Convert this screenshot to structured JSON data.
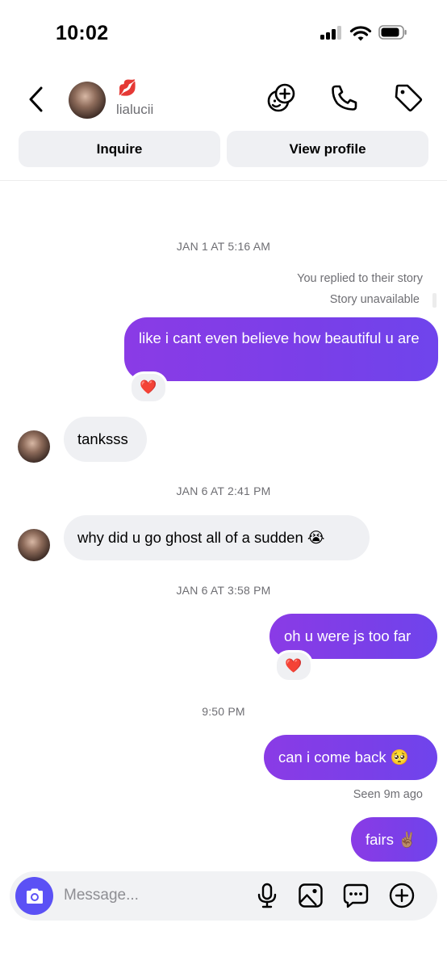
{
  "status_bar": {
    "time": "10:02"
  },
  "header": {
    "username": "lialucii",
    "emoji": "💋",
    "inquire_label": "Inquire",
    "view_profile_label": "View profile"
  },
  "messages": {
    "stamp1": "JAN 1 AT 5:16 AM",
    "story_reply": "You replied to their story",
    "story_unavailable": "Story unavailable",
    "out1": "like i cant even believe how beautiful u are",
    "react1": "❤️",
    "in1": "tanksss",
    "stamp2": "JAN 6 AT 2:41 PM",
    "in2": "why did u go ghost all of a sudden 😭",
    "stamp3": "JAN 6 AT 3:58 PM",
    "out2": "oh u were js too far",
    "react2": "❤️",
    "stamp4": "9:50 PM",
    "out3": "can i come back 🥺",
    "seen": "Seen 9m ago",
    "out4": "fairs ✌🏽"
  },
  "composer": {
    "placeholder": "Message..."
  },
  "icons": {
    "back": "chevron-left-icon",
    "stickers": "add-sticker-icon",
    "call": "phone-icon",
    "tag": "tag-icon",
    "camera": "camera-icon",
    "mic": "microphone-icon",
    "gallery": "image-icon",
    "chat": "message-dots-icon",
    "add": "plus-circle-icon"
  },
  "colors": {
    "outgoing_bubble": "#7a3fe8",
    "incoming_bubble": "#eff0f3",
    "camera_button": "#5b51f5"
  }
}
